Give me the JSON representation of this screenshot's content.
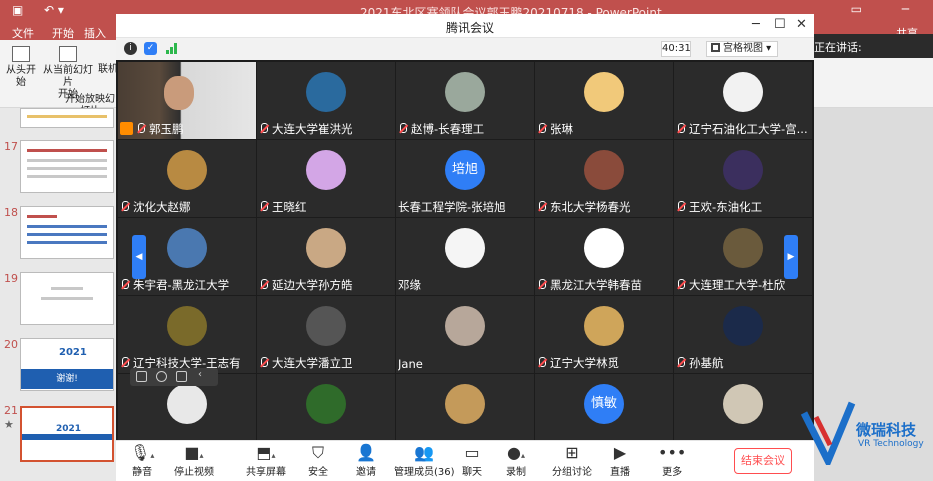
{
  "ppt": {
    "title": "2021东北区赛领队会议郭玉鹏20210718 - PowerPoint",
    "tabs": [
      "文件",
      "开始",
      "插入"
    ],
    "ribbon": {
      "from_start": "从头开始",
      "from_current_line1": "从当前幻灯片",
      "from_current_line2": "开始",
      "online": "联机",
      "group": "开始放映幻灯片"
    },
    "slides": [
      {
        "num": "17"
      },
      {
        "num": "18"
      },
      {
        "num": "19"
      },
      {
        "num": "20",
        "text": "2021",
        "footer": "谢谢!"
      },
      {
        "num": "21",
        "star": "★",
        "text": "2021"
      }
    ],
    "share_label": "共享"
  },
  "meeting": {
    "window_title": "腾讯会议",
    "timer": "40:31",
    "view_mode": "宫格视图",
    "speaking_label": "正在讲话:",
    "participants": [
      {
        "name": "郭玉鹏",
        "type": "video"
      },
      {
        "name": "大连大学崔洪光",
        "color": "#2a6a9e"
      },
      {
        "name": "赵博-长春理工",
        "color": "#9aa89c"
      },
      {
        "name": "张琳",
        "color": "#f1c97a"
      },
      {
        "name": "辽宁石油化工大学-宫...",
        "color": "#f2f2f2"
      },
      {
        "name": "沈化大赵娜",
        "color": "#b88a42"
      },
      {
        "name": "王晓红",
        "color": "#d3a6e6"
      },
      {
        "name": "长春工程学院-张培旭",
        "initials": "培旭",
        "color": "#2f7ef6"
      },
      {
        "name": "东北大学杨春光",
        "color": "#8a4b3b"
      },
      {
        "name": "王欢-东油化工",
        "color": "#3b2f5e"
      },
      {
        "name": "朱宇君-黑龙江大学",
        "color": "#4a78b0"
      },
      {
        "name": "延边大学孙方皓",
        "color": "#c9a884"
      },
      {
        "name": "邓缘",
        "color": "#f5f5f5"
      },
      {
        "name": "黑龙江大学韩春苗",
        "color": "#ffffff"
      },
      {
        "name": "大连理工大学-杜欣",
        "color": "#6a5a3c"
      },
      {
        "name": "辽宁科技大学-王志有",
        "color": "#7a6a2a"
      },
      {
        "name": "大连大学潘立卫",
        "color": "#555555"
      },
      {
        "name": "Jane",
        "color": "#b7a79a"
      },
      {
        "name": "辽宁大学林觅",
        "color": "#cfa55a"
      },
      {
        "name": "孙基航",
        "color": "#1b2a4a"
      },
      {
        "name": "",
        "color": "#e8e8e8"
      },
      {
        "name": "",
        "color": "#2f6b2a"
      },
      {
        "name": "",
        "color": "#c49a5a"
      },
      {
        "name": "",
        "initials": "慎敏",
        "color": "#2f7ef6"
      },
      {
        "name": "",
        "color": "#d0c7b5"
      }
    ],
    "toolbar": {
      "mute": "静音",
      "stop_video": "停止视频",
      "share_screen": "共享屏幕",
      "security": "安全",
      "invite": "邀请",
      "manage_members": "管理成员(36)",
      "chat": "聊天",
      "record": "录制",
      "breakout": "分组讨论",
      "live": "直播",
      "more": "更多",
      "end_meeting": "结束会议"
    }
  },
  "watermark": {
    "brand": "微瑞科技",
    "sub": "VR Technology"
  },
  "colors": {
    "ppt_accent": "#c0504d",
    "meeting_blue": "#2f7ef6",
    "end_red": "#ff4d4f"
  }
}
